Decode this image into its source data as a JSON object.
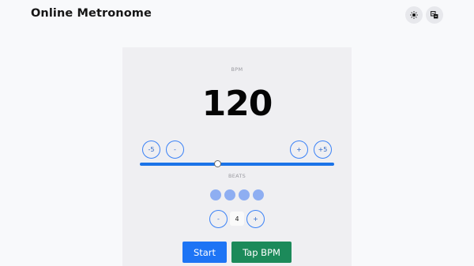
{
  "header": {
    "title": "Online Metronome",
    "theme_icon": "sun-icon",
    "language_icon": "translate-icon"
  },
  "metronome": {
    "bpm_label": "BPM",
    "bpm": "120",
    "adjust": {
      "minus5": "-5",
      "minus1": "-",
      "plus1": "+",
      "plus5": "+5"
    },
    "slider_level": 0.4,
    "beats_label": "BEATS",
    "beats": [
      1,
      2,
      3,
      4
    ],
    "beat_count": "4",
    "beat_minus": "-",
    "beat_plus": "+",
    "start_label": "Start",
    "tap_label": "Tap BPM"
  },
  "colors": {
    "accent": "#1d74f5",
    "tap": "#1c8a5a",
    "beat_dot": "#8eaef2"
  }
}
